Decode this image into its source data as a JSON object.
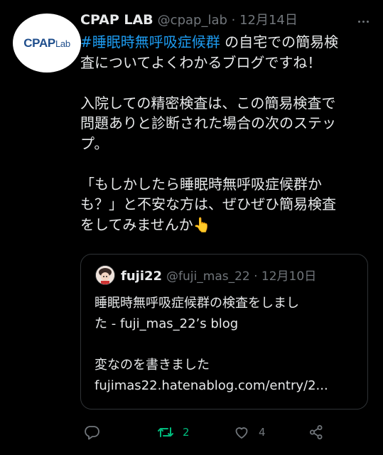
{
  "tweet": {
    "author_name": "CPAP LAB",
    "meta": "@cpap_lab · 12月14日",
    "logo_main": "CPAP",
    "logo_sub": "Lab",
    "hashtag": "#睡眠時無呼吸症候群",
    "line1_rest": " の自宅での簡易検",
    "line2": "査についてよくわかるブログですね！",
    "line4": "入院しての精密検査は、この簡易検査で",
    "line5": "問題ありと診断された場合の次のステッ",
    "line6": "プ。",
    "line8": "「もしかしたら睡眠時無呼吸症候群か",
    "line9": "も？」と不安な方は、ぜひぜひ簡易検査",
    "line10": "をしてみませんか",
    "emoji": "👆"
  },
  "quoted": {
    "author_name": "fuji22",
    "meta": "@fuji_mas_22 · 12月10日",
    "line1": "睡眠時無呼吸症候群の検査をしまし",
    "line2": "た - fuji_mas_22’s blog",
    "line4": "変なのを書きました",
    "line5": "fujimas22.hatenablog.com/entry/2..."
  },
  "actions": {
    "reply_count": "",
    "retweet_count": "2",
    "like_count": "4",
    "colors": {
      "retweet_active": "#00ba7c",
      "muted": "#71767b",
      "hashtag": "#1d9bf0"
    },
    "icons": [
      "reply-icon",
      "retweet-icon",
      "like-icon",
      "share-icon"
    ]
  }
}
